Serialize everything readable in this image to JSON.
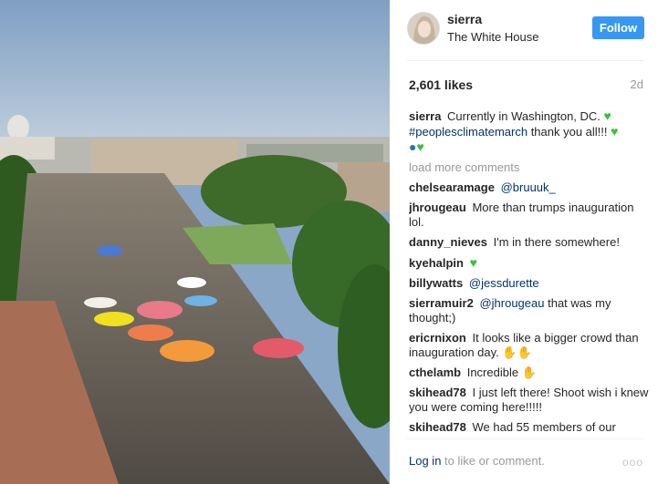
{
  "post": {
    "username": "sierra",
    "location": "The White House",
    "follow_label": "Follow",
    "likes": "2,601 likes",
    "age": "2d"
  },
  "caption": {
    "user": "sierra",
    "text": "Currently in Washington, DC.",
    "hashtag": "#peoplesclimatemarch",
    "text2": " thank you all!!!"
  },
  "load_more_label": "load more comments",
  "comments": [
    {
      "user": "chelsearamage",
      "mention": "@bruuuk_",
      "text": ""
    },
    {
      "user": "jhrougeau",
      "mention": "",
      "text": "More than trumps inauguration lol."
    },
    {
      "user": "danny_nieves",
      "mention": "",
      "text": "I'm in there somewhere!"
    },
    {
      "user": "kyehalpin",
      "mention": "",
      "text": ""
    },
    {
      "user": "billywatts",
      "mention": "@jessdurette",
      "text": ""
    },
    {
      "user": "sierramuir2",
      "mention": "@jhrougeau",
      "text": "that was my thought;)"
    },
    {
      "user": "ericrnixon",
      "mention": "",
      "text": "It looks like a bigger crowd than inauguration day."
    },
    {
      "user": "cthelamb",
      "mention": "",
      "text": "Incredible"
    },
    {
      "user": "skihead78",
      "mention": "",
      "text": "I just left there! Shoot wish i knew you were coming here!!!!!"
    },
    {
      "user": "skihead78",
      "mention": "",
      "text": "We had 55 members of our"
    }
  ],
  "footer": {
    "login": "Log in",
    "rest": " to like or comment.",
    "more": "ooo"
  },
  "colors": {
    "follow_bg": "#3897f0",
    "link": "#003569",
    "muted": "#999999"
  }
}
